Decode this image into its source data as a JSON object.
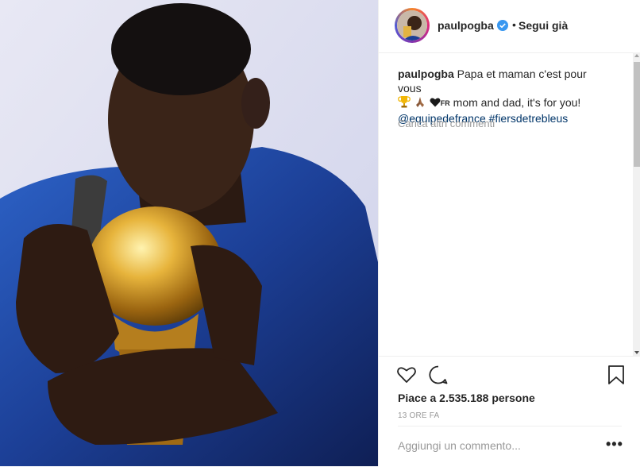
{
  "post": {
    "image_alt": "",
    "username": "paulpogba",
    "separator": "•",
    "follow_label": "Segui già",
    "caption": {
      "username": "paulpogba",
      "text_line1": "Papa et maman c'est pour vous",
      "emoji_icons": [
        "trophy-icon",
        "praying-hands-icon",
        "heart-icon",
        "flag-fr-icon"
      ],
      "flag_text": "FR",
      "text_line2": "mom and dad, it's for you!",
      "mention": "@equipedefrance",
      "hashtag": "#fiersdetrebleus"
    },
    "load_more_label": "Carica altri commenti",
    "likes_label": "Piace a 2.535.188 persone",
    "timestamp": "13 ORE FA",
    "comment_placeholder": "Aggiungi un commento...",
    "more_options": "•••"
  },
  "colors": {
    "verified": "#3897f0",
    "link": "#003569",
    "muted": "#999999"
  }
}
